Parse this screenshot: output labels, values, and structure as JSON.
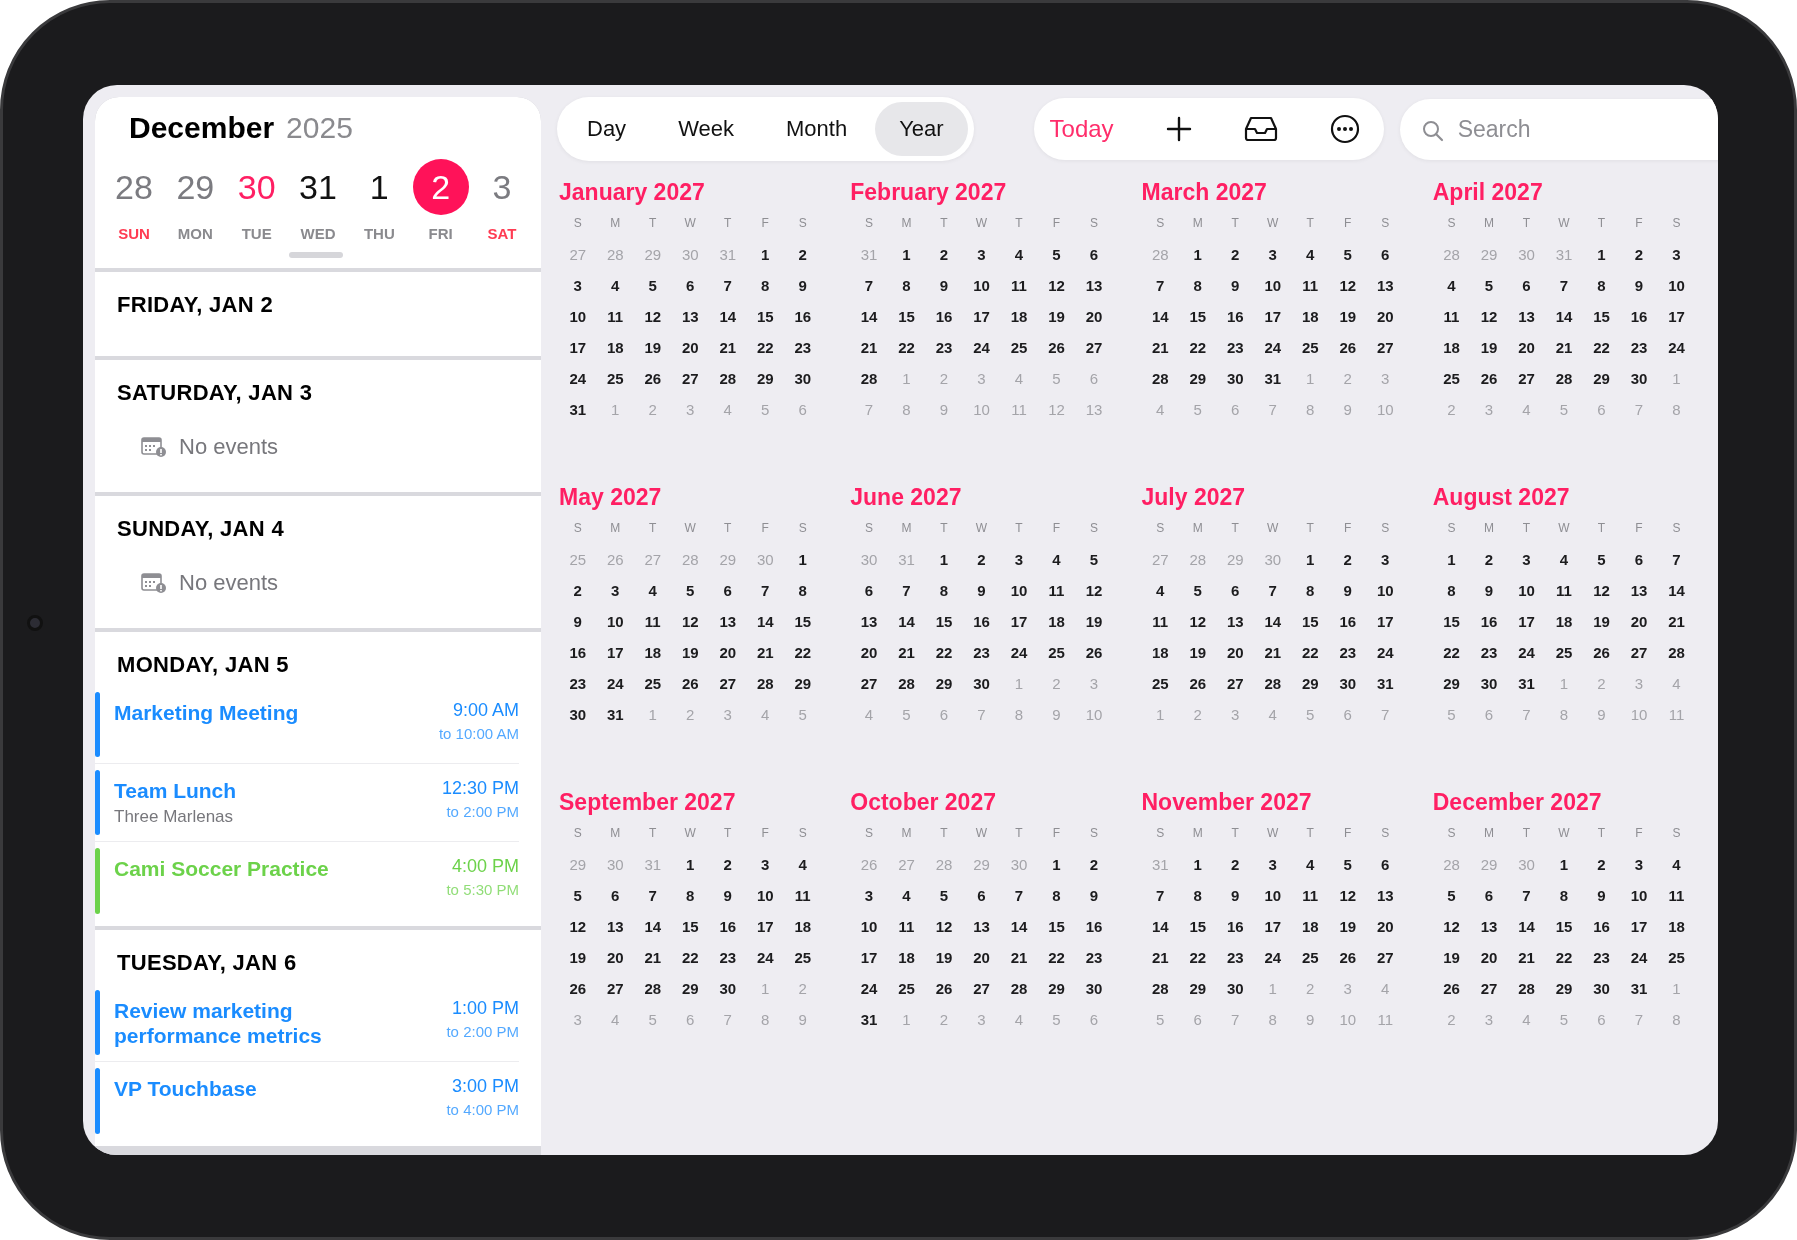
{
  "sidebar": {
    "month": "December",
    "year": "2025",
    "week": [
      {
        "day": "28",
        "weekday": "SUN",
        "weekend": true,
        "color": "#7b7b80",
        "selected": false
      },
      {
        "day": "29",
        "weekday": "MON",
        "weekend": false,
        "color": "#7b7b80",
        "selected": false
      },
      {
        "day": "30",
        "weekday": "TUE",
        "weekend": false,
        "color": "#ff1f63",
        "selected": false
      },
      {
        "day": "31",
        "weekday": "WED",
        "weekend": false,
        "color": "#111111",
        "selected": false
      },
      {
        "day": "1",
        "weekday": "THU",
        "weekend": false,
        "color": "#111111",
        "selected": false
      },
      {
        "day": "2",
        "weekday": "FRI",
        "weekend": false,
        "selected": true
      },
      {
        "day": "3",
        "weekday": "SAT",
        "weekend": true,
        "color": "#7b7b80",
        "selected": false
      }
    ],
    "agenda": [
      {
        "heading": "FRIDAY, JAN 2"
      },
      {
        "heading": "SATURDAY, JAN 3",
        "empty_text": "No events"
      },
      {
        "heading": "SUNDAY, JAN 4",
        "empty_text": "No events"
      },
      {
        "heading": "MONDAY, JAN 5",
        "events": [
          {
            "title": "Marketing Meeting",
            "start": "9:00 AM",
            "end": "to 10:00 AM",
            "color": "#1a8cff"
          },
          {
            "title": "Team Lunch",
            "location": "Three Marlenas",
            "start": "12:30 PM",
            "end": "to 2:00 PM",
            "color": "#1a8cff"
          },
          {
            "title": "Cami Soccer Practice",
            "start": "4:00 PM",
            "end": "to 5:30 PM",
            "color": "#6cd24a"
          }
        ]
      },
      {
        "heading": "TUESDAY, JAN 6",
        "events": [
          {
            "title": "Review marketing performance metrics",
            "start": "1:00 PM",
            "end": "to 2:00 PM",
            "color": "#1a8cff"
          },
          {
            "title": "VP Touchbase",
            "start": "3:00 PM",
            "end": "to 4:00 PM",
            "color": "#1a8cff"
          }
        ]
      }
    ]
  },
  "toolbar": {
    "views": [
      {
        "label": "Day",
        "selected": false
      },
      {
        "label": "Week",
        "selected": false
      },
      {
        "label": "Month",
        "selected": false
      },
      {
        "label": "Year",
        "selected": true
      }
    ],
    "today": "Today",
    "search": {
      "placeholder": "Search"
    }
  },
  "months": [
    {
      "title": "January 2027",
      "weekdays": [
        "S",
        "M",
        "T",
        "W",
        "T",
        "F",
        "S"
      ],
      "leading": [
        "27",
        "28",
        "29",
        "30",
        "31"
      ],
      "days": [
        "1",
        "2",
        "3",
        "4",
        "5",
        "6",
        "7",
        "8",
        "9",
        "10",
        "11",
        "12",
        "13",
        "14",
        "15",
        "16",
        "17",
        "18",
        "19",
        "20",
        "21",
        "22",
        "23",
        "24",
        "25",
        "26",
        "27",
        "28",
        "29",
        "30",
        "31"
      ],
      "trailing": [
        "1",
        "2",
        "3",
        "4",
        "5",
        "6"
      ]
    },
    {
      "title": "February 2027",
      "weekdays": [
        "S",
        "M",
        "T",
        "W",
        "T",
        "F",
        "S"
      ],
      "leading": [
        "31"
      ],
      "days": [
        "1",
        "2",
        "3",
        "4",
        "5",
        "6",
        "7",
        "8",
        "9",
        "10",
        "11",
        "12",
        "13",
        "14",
        "15",
        "16",
        "17",
        "18",
        "19",
        "20",
        "21",
        "22",
        "23",
        "24",
        "25",
        "26",
        "27",
        "28"
      ],
      "trailing": [
        "1",
        "2",
        "3",
        "4",
        "5",
        "6",
        "7",
        "8",
        "9",
        "10",
        "11",
        "12",
        "13"
      ]
    },
    {
      "title": "March 2027",
      "weekdays": [
        "S",
        "M",
        "T",
        "W",
        "T",
        "F",
        "S"
      ],
      "leading": [
        "28"
      ],
      "days": [
        "1",
        "2",
        "3",
        "4",
        "5",
        "6",
        "7",
        "8",
        "9",
        "10",
        "11",
        "12",
        "13",
        "14",
        "15",
        "16",
        "17",
        "18",
        "19",
        "20",
        "21",
        "22",
        "23",
        "24",
        "25",
        "26",
        "27",
        "28",
        "29",
        "30",
        "31"
      ],
      "trailing": [
        "1",
        "2",
        "3",
        "4",
        "5",
        "6",
        "7",
        "8",
        "9",
        "10"
      ]
    },
    {
      "title": "April 2027",
      "weekdays": [
        "S",
        "M",
        "T",
        "W",
        "T",
        "F",
        "S"
      ],
      "leading": [
        "28",
        "29",
        "30",
        "31"
      ],
      "days": [
        "1",
        "2",
        "3",
        "4",
        "5",
        "6",
        "7",
        "8",
        "9",
        "10",
        "11",
        "12",
        "13",
        "14",
        "15",
        "16",
        "17",
        "18",
        "19",
        "20",
        "21",
        "22",
        "23",
        "24",
        "25",
        "26",
        "27",
        "28",
        "29",
        "30"
      ],
      "trailing": [
        "1",
        "2",
        "3",
        "4",
        "5",
        "6",
        "7",
        "8"
      ]
    },
    {
      "title": "May 2027",
      "weekdays": [
        "S",
        "M",
        "T",
        "W",
        "T",
        "F",
        "S"
      ],
      "leading": [
        "25",
        "26",
        "27",
        "28",
        "29",
        "30"
      ],
      "days": [
        "1",
        "2",
        "3",
        "4",
        "5",
        "6",
        "7",
        "8",
        "9",
        "10",
        "11",
        "12",
        "13",
        "14",
        "15",
        "16",
        "17",
        "18",
        "19",
        "20",
        "21",
        "22",
        "23",
        "24",
        "25",
        "26",
        "27",
        "28",
        "29",
        "30",
        "31"
      ],
      "trailing": [
        "1",
        "2",
        "3",
        "4",
        "5"
      ]
    },
    {
      "title": "June 2027",
      "weekdays": [
        "S",
        "M",
        "T",
        "W",
        "T",
        "F",
        "S"
      ],
      "leading": [
        "30",
        "31"
      ],
      "days": [
        "1",
        "2",
        "3",
        "4",
        "5",
        "6",
        "7",
        "8",
        "9",
        "10",
        "11",
        "12",
        "13",
        "14",
        "15",
        "16",
        "17",
        "18",
        "19",
        "20",
        "21",
        "22",
        "23",
        "24",
        "25",
        "26",
        "27",
        "28",
        "29",
        "30"
      ],
      "trailing": [
        "1",
        "2",
        "3",
        "4",
        "5",
        "6",
        "7",
        "8",
        "9",
        "10"
      ]
    },
    {
      "title": "July 2027",
      "weekdays": [
        "S",
        "M",
        "T",
        "W",
        "T",
        "F",
        "S"
      ],
      "leading": [
        "27",
        "28",
        "29",
        "30"
      ],
      "days": [
        "1",
        "2",
        "3",
        "4",
        "5",
        "6",
        "7",
        "8",
        "9",
        "10",
        "11",
        "12",
        "13",
        "14",
        "15",
        "16",
        "17",
        "18",
        "19",
        "20",
        "21",
        "22",
        "23",
        "24",
        "25",
        "26",
        "27",
        "28",
        "29",
        "30",
        "31"
      ],
      "trailing": [
        "1",
        "2",
        "3",
        "4",
        "5",
        "6",
        "7"
      ]
    },
    {
      "title": "August 2027",
      "weekdays": [
        "S",
        "M",
        "T",
        "W",
        "T",
        "F",
        "S"
      ],
      "days": [
        "1",
        "2",
        "3",
        "4",
        "5",
        "6",
        "7",
        "8",
        "9",
        "10",
        "11",
        "12",
        "13",
        "14",
        "15",
        "16",
        "17",
        "18",
        "19",
        "20",
        "21",
        "22",
        "23",
        "24",
        "25",
        "26",
        "27",
        "28",
        "29",
        "30",
        "31"
      ],
      "trailing": [
        "1",
        "2",
        "3",
        "4",
        "5",
        "6",
        "7",
        "8",
        "9",
        "10",
        "11"
      ]
    },
    {
      "title": "September 2027",
      "weekdays": [
        "S",
        "M",
        "T",
        "W",
        "T",
        "F",
        "S"
      ],
      "leading": [
        "29",
        "30",
        "31"
      ],
      "days": [
        "1",
        "2",
        "3",
        "4",
        "5",
        "6",
        "7",
        "8",
        "9",
        "10",
        "11",
        "12",
        "13",
        "14",
        "15",
        "16",
        "17",
        "18",
        "19",
        "20",
        "21",
        "22",
        "23",
        "24",
        "25",
        "26",
        "27",
        "28",
        "29",
        "30"
      ],
      "trailing": [
        "1",
        "2",
        "3",
        "4",
        "5",
        "6",
        "7",
        "8",
        "9"
      ]
    },
    {
      "title": "October 2027",
      "weekdays": [
        "S",
        "M",
        "T",
        "W",
        "T",
        "F",
        "S"
      ],
      "leading": [
        "26",
        "27",
        "28",
        "29",
        "30"
      ],
      "days": [
        "1",
        "2",
        "3",
        "4",
        "5",
        "6",
        "7",
        "8",
        "9",
        "10",
        "11",
        "12",
        "13",
        "14",
        "15",
        "16",
        "17",
        "18",
        "19",
        "20",
        "21",
        "22",
        "23",
        "24",
        "25",
        "26",
        "27",
        "28",
        "29",
        "30",
        "31"
      ],
      "trailing": [
        "1",
        "2",
        "3",
        "4",
        "5",
        "6"
      ]
    },
    {
      "title": "November 2027",
      "weekdays": [
        "S",
        "M",
        "T",
        "W",
        "T",
        "F",
        "S"
      ],
      "leading": [
        "31"
      ],
      "days": [
        "1",
        "2",
        "3",
        "4",
        "5",
        "6",
        "7",
        "8",
        "9",
        "10",
        "11",
        "12",
        "13",
        "14",
        "15",
        "16",
        "17",
        "18",
        "19",
        "20",
        "21",
        "22",
        "23",
        "24",
        "25",
        "26",
        "27",
        "28",
        "29",
        "30"
      ],
      "trailing": [
        "1",
        "2",
        "3",
        "4",
        "5",
        "6",
        "7",
        "8",
        "9",
        "10",
        "11"
      ]
    },
    {
      "title": "December 2027",
      "weekdays": [
        "S",
        "M",
        "T",
        "W",
        "T",
        "F",
        "S"
      ],
      "leading": [
        "28",
        "29",
        "30"
      ],
      "days": [
        "1",
        "2",
        "3",
        "4",
        "5",
        "6",
        "7",
        "8",
        "9",
        "10",
        "11",
        "12",
        "13",
        "14",
        "15",
        "16",
        "17",
        "18",
        "19",
        "20",
        "21",
        "22",
        "23",
        "24",
        "25",
        "26",
        "27",
        "28",
        "29",
        "30",
        "31"
      ],
      "trailing": [
        "1",
        "2",
        "3",
        "4",
        "5",
        "6",
        "7",
        "8"
      ]
    }
  ]
}
